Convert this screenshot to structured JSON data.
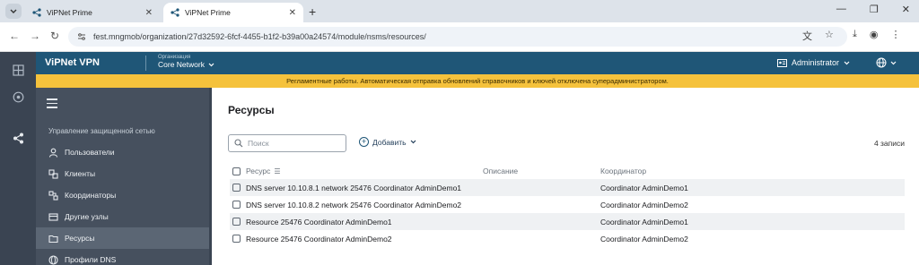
{
  "browser": {
    "tabs": [
      {
        "title": "ViPNet Prime",
        "active": false
      },
      {
        "title": "ViPNet Prime",
        "active": true
      }
    ],
    "url": "fest.mngmob/organization/27d32592-6fcf-4455-b1f2-b39a00a24574/module/nsms/resources/"
  },
  "header": {
    "brand": "ViPNet VPN",
    "org_caption": "Организация",
    "org_name": "Core Network",
    "user": "Administrator"
  },
  "banner": {
    "text": "Регламентные работы. Автоматическая отправка обновлений справочников и ключей отключена суперадминистратором."
  },
  "sidebar": {
    "section_title": "Управление защищенной сетью",
    "items": [
      {
        "label": "Пользователи",
        "icon": "user-icon",
        "active": false
      },
      {
        "label": "Клиенты",
        "icon": "clients-icon",
        "active": false
      },
      {
        "label": "Координаторы",
        "icon": "coordinators-icon",
        "active": false
      },
      {
        "label": "Другие узлы",
        "icon": "other-nodes-icon",
        "active": false
      },
      {
        "label": "Ресурсы",
        "icon": "folder-icon",
        "active": true
      },
      {
        "label": "Профили DNS",
        "icon": "globe-icon",
        "active": false
      }
    ]
  },
  "main": {
    "title": "Ресурсы",
    "search_placeholder": "Поиск",
    "add_label": "Добавить",
    "count": "4 записи",
    "columns": [
      "Ресурс",
      "Описание",
      "Координатор"
    ],
    "rows": [
      {
        "resource": "DNS server 10.10.8.1 network 25476 Coordinator AdminDemo1",
        "description": "",
        "coordinator": "Coordinator AdminDemo1"
      },
      {
        "resource": "DNS server 10.10.8.2 network 25476 Coordinator AdminDemo2",
        "description": "",
        "coordinator": "Coordinator AdminDemo2"
      },
      {
        "resource": "Resource 25476 Coordinator AdminDemo1",
        "description": "",
        "coordinator": "Coordinator AdminDemo1"
      },
      {
        "resource": "Resource 25476 Coordinator AdminDemo2",
        "description": "",
        "coordinator": "Coordinator AdminDemo2"
      }
    ]
  },
  "colors": {
    "header_bg": "#1f5677",
    "banner_bg": "#f5c23c",
    "sidebar_bg": "#46505e",
    "rail_bg": "#3a4452",
    "active_item_bg": "#5b6674"
  }
}
